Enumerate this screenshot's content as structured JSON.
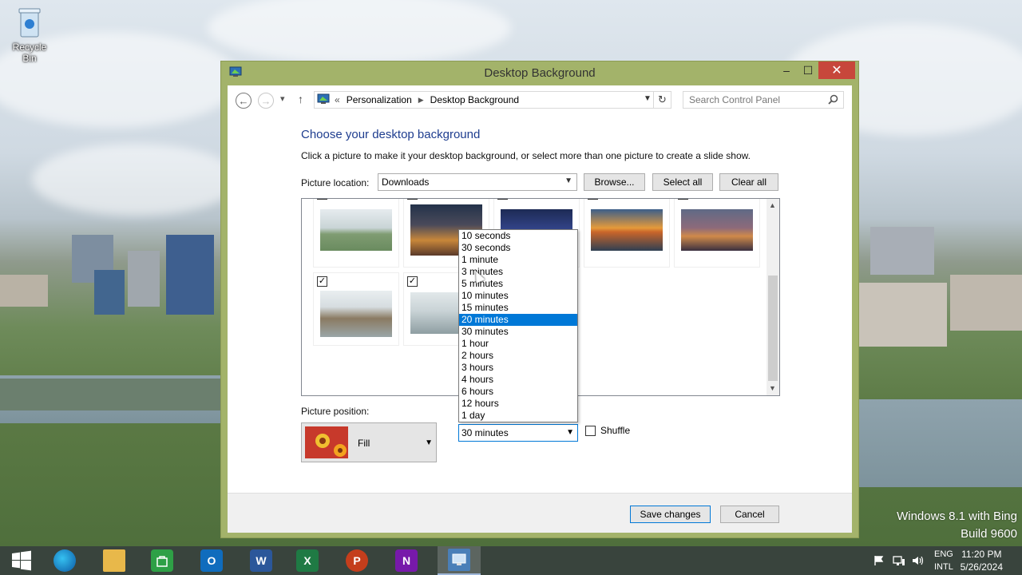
{
  "desktop": {
    "recycle_bin_label": "Recycle Bin",
    "watermark_line1": "Windows 8.1 with Bing",
    "watermark_line2": "Build 9600"
  },
  "window": {
    "title": "Desktop Background",
    "controls": {
      "minimize": "–",
      "maximize": "☐",
      "close": "✕"
    }
  },
  "navigation": {
    "back": "←",
    "forward": "→",
    "recent": "▾",
    "up": "↑",
    "breadcrumb_prefix": "«",
    "breadcrumb": [
      "Personalization",
      "Desktop Background"
    ],
    "refresh": "↻",
    "search_placeholder": "Search Control Panel"
  },
  "content": {
    "heading": "Choose your desktop background",
    "description": "Click a picture to make it your desktop background, or select more than one picture to create a slide show.",
    "picture_location_label": "Picture location:",
    "picture_location_value": "Downloads",
    "browse_label": "Browse...",
    "select_all_label": "Select all",
    "clear_all_label": "Clear all",
    "picture_position_label": "Picture position:",
    "picture_position_value": "Fill",
    "change_interval_value": "30 minutes",
    "shuffle_label": "Shuffle"
  },
  "interval_dropdown": {
    "options": [
      "10 seconds",
      "30 seconds",
      "1 minute",
      "3 minutes",
      "5 minutes",
      "10 minutes",
      "15 minutes",
      "20 minutes",
      "30 minutes",
      "1 hour",
      "2 hours",
      "3 hours",
      "4 hours",
      "6 hours",
      "12 hours",
      "1 day"
    ],
    "highlighted": "20 minutes"
  },
  "footer": {
    "save_label": "Save changes",
    "cancel_label": "Cancel"
  },
  "taskbar": {
    "apps": [
      "start",
      "edge",
      "file-explorer",
      "store",
      "outlook",
      "word",
      "excel",
      "powerpoint",
      "onenote",
      "control-panel"
    ],
    "app_letters": {
      "outlook": "O",
      "word": "W",
      "excel": "X",
      "powerpoint": "P",
      "onenote": "N"
    },
    "language_line1": "ENG",
    "language_line2": "INTL",
    "time": "11:20 PM",
    "date": "5/26/2024"
  },
  "colors": {
    "heading_blue": "#1e3d8f",
    "selection_blue": "#0078d7",
    "window_frame": "#a3b36a",
    "close_red": "#c7473b"
  }
}
